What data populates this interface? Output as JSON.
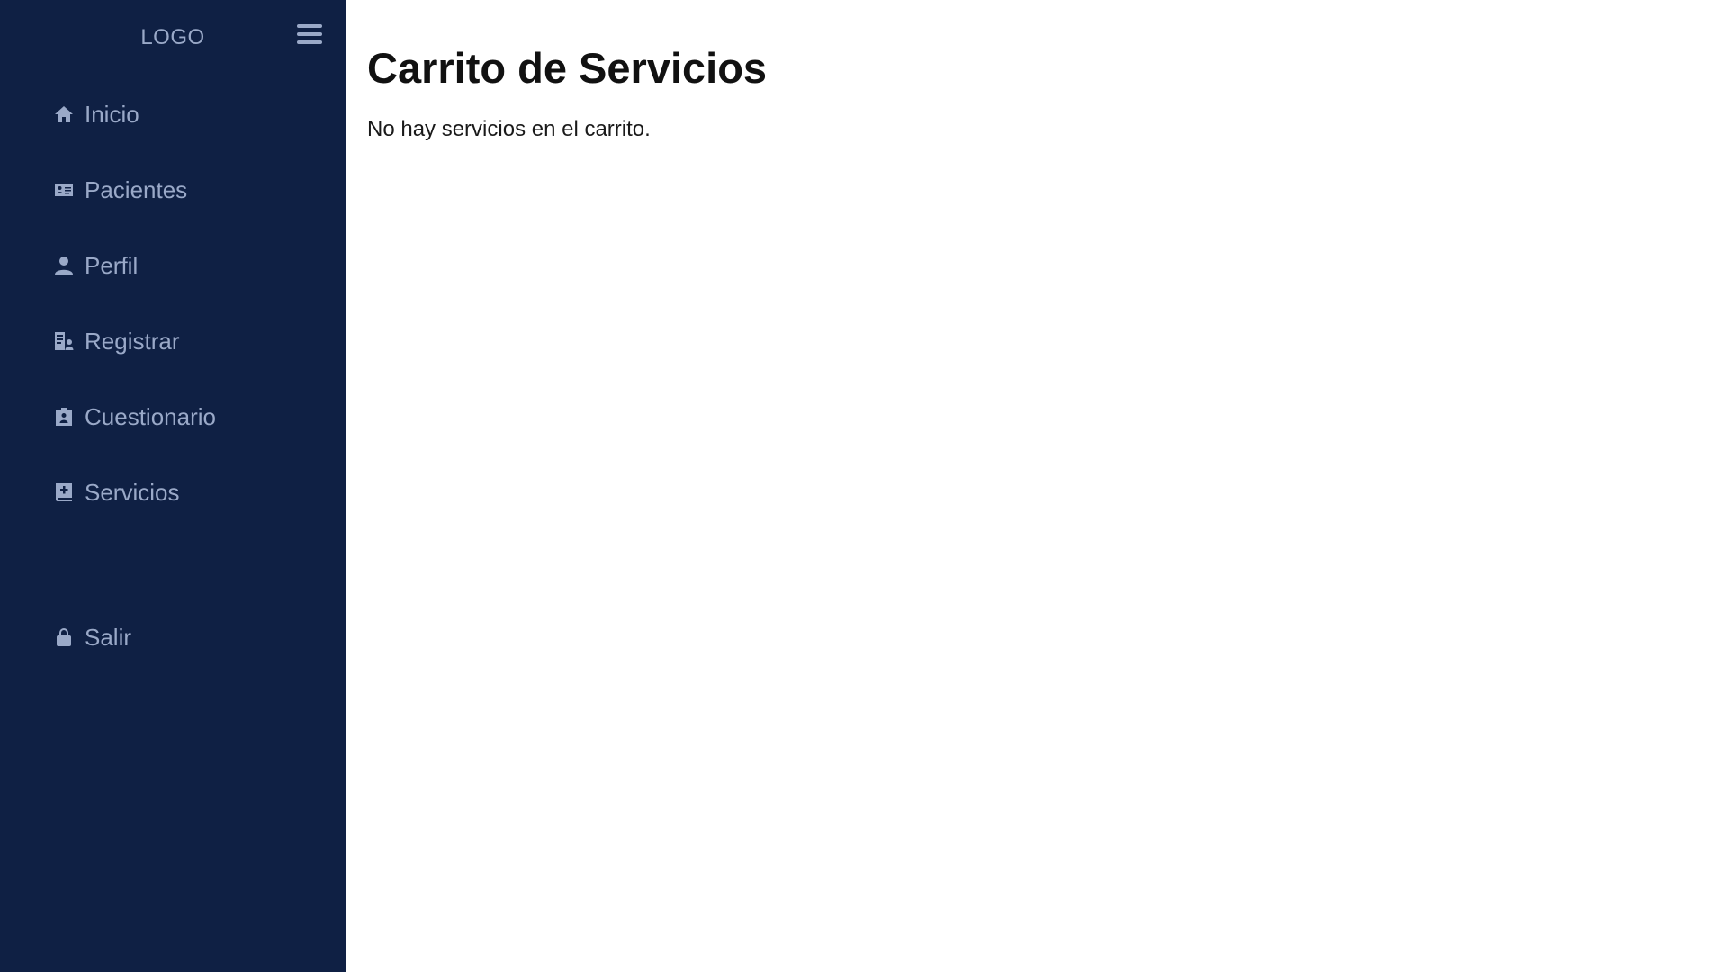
{
  "sidebar": {
    "logo": "LOGO",
    "toggle_icon": "hamburger-menu-icon",
    "items": [
      {
        "label": "Inicio",
        "icon": "home-icon"
      },
      {
        "label": "Pacientes",
        "icon": "id-card-icon"
      },
      {
        "label": "Perfil",
        "icon": "user-icon"
      },
      {
        "label": "Registrar",
        "icon": "register-user-icon"
      },
      {
        "label": "Cuestionario",
        "icon": "clipboard-user-icon"
      },
      {
        "label": "Servicios",
        "icon": "book-medical-icon"
      }
    ],
    "logout": {
      "label": "Salir",
      "icon": "lock-icon"
    }
  },
  "main": {
    "title": "Carrito de Servicios",
    "empty_message": "No hay servicios en el carrito."
  },
  "colors": {
    "sidebar_bg": "#0f2044",
    "sidebar_text": "#9aa9c8",
    "main_bg": "#ffffff",
    "title_text": "#111111"
  }
}
